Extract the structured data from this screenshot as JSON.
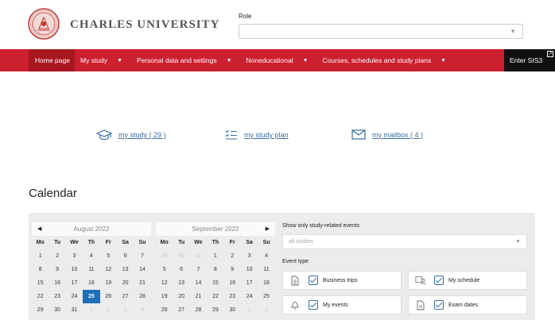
{
  "header": {
    "university_name": "CHARLES UNIVERSITY",
    "role_label": "Role",
    "role_value": ""
  },
  "nav": {
    "items": [
      {
        "label": "Home page",
        "active": true,
        "has_caret": false
      },
      {
        "label": "My study",
        "active": false,
        "has_caret": true
      },
      {
        "label": "Personal data and settings",
        "active": false,
        "has_caret": true
      },
      {
        "label": "Noneducational",
        "active": false,
        "has_caret": true
      },
      {
        "label": "Courses, schedules and study plans",
        "active": false,
        "has_caret": true
      }
    ],
    "enter_label": "Enter SIS3"
  },
  "quick_links": {
    "my_study": "my study ( 29 )",
    "my_study_plan": "my study plan",
    "my_mailbox": "my mailbox ( 4 )"
  },
  "calendar": {
    "title": "Calendar",
    "weekdays": [
      "Mo",
      "Tu",
      "We",
      "Th",
      "Fr",
      "Sa",
      "Su"
    ],
    "months": [
      {
        "name": "August 2022",
        "weeks": [
          [
            "1",
            "2",
            "3",
            "4",
            "5",
            "6",
            "7"
          ],
          [
            "8",
            "9",
            "10",
            "11",
            "12",
            "13",
            "14"
          ],
          [
            "15",
            "16",
            "17",
            "18",
            "19",
            "20",
            "21"
          ],
          [
            "22",
            "23",
            "24",
            "25",
            "26",
            "27",
            "28"
          ],
          [
            "29",
            "30",
            "31",
            "1",
            "2",
            "3",
            "4"
          ]
        ],
        "muted_last_row_from": 3,
        "today": "25"
      },
      {
        "name": "September 2022",
        "weeks": [
          [
            "29",
            "30",
            "31",
            "1",
            "2",
            "3",
            "4"
          ],
          [
            "5",
            "6",
            "7",
            "8",
            "9",
            "10",
            "11"
          ],
          [
            "12",
            "13",
            "14",
            "15",
            "16",
            "17",
            "18"
          ],
          [
            "19",
            "20",
            "21",
            "22",
            "23",
            "24",
            "25"
          ],
          [
            "26",
            "27",
            "28",
            "29",
            "30",
            "1",
            "2"
          ]
        ],
        "muted_first_row_until": 3,
        "muted_last_row_from": 5
      }
    ],
    "filter_label": "Show only study-related events",
    "filter_placeholder": "all studies",
    "event_type_label": "Event type",
    "event_types": [
      {
        "label": "Business trips",
        "icon": "document-icon",
        "checked": true
      },
      {
        "label": "My schedule",
        "icon": "schedule-icon",
        "checked": true
      },
      {
        "label": "My events",
        "icon": "bell-icon",
        "checked": true
      },
      {
        "label": "Exam dates",
        "icon": "exam-document-icon",
        "checked": true
      }
    ]
  },
  "colors": {
    "nav_red": "#cc1f2f",
    "link_blue": "#3a6ea5",
    "today_blue": "#1f6fb8"
  }
}
